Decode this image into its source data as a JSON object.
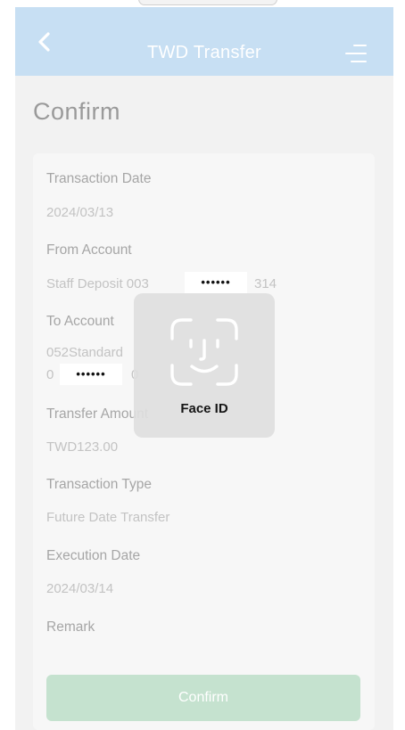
{
  "header": {
    "title": "TWD Transfer",
    "back_icon": "chevron-left-icon",
    "menu_icon": "menu-icon",
    "background": "#c7dff3"
  },
  "page": {
    "heading": "Confirm"
  },
  "details": {
    "transaction_date": {
      "label": "Transaction Date",
      "value": "2024/03/13"
    },
    "from_account": {
      "label": "From Account",
      "value_prefix": "Staff Deposit 003",
      "masked": "••••••",
      "value_suffix": "314"
    },
    "to_account": {
      "label": "To Account",
      "value_line1": "052Standard",
      "value_line2_prefix": "0",
      "masked": "••••••",
      "value_line2_suffix": "0"
    },
    "transfer_amount": {
      "label": "Transfer Amount",
      "value": "TWD123.00"
    },
    "transaction_type": {
      "label": "Transaction Type",
      "value": "Future Date Transfer"
    },
    "execution_date": {
      "label": "Execution Date",
      "value": "2024/03/14"
    },
    "remark": {
      "label": "Remark"
    }
  },
  "actions": {
    "confirm_label": "Confirm",
    "confirm_color": "#c5e2cf"
  },
  "overlay": {
    "label": "Face ID",
    "icon": "face-id-icon"
  }
}
